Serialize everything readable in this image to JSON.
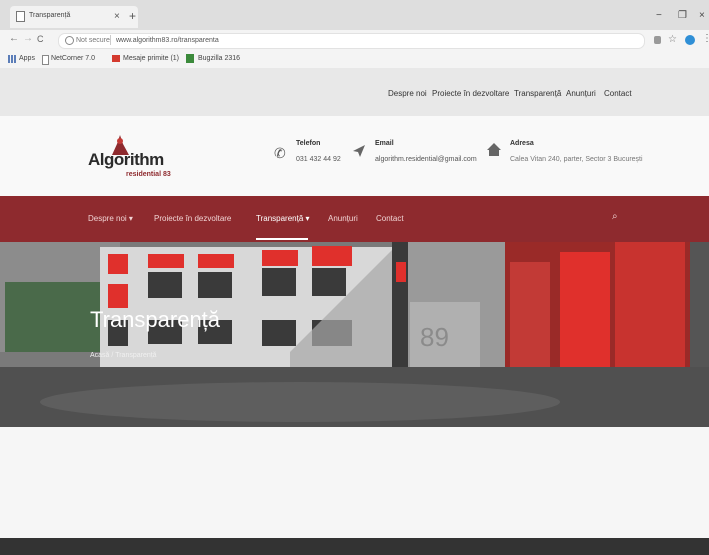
{
  "browser": {
    "tab_title": "Transparență",
    "close_glyph": "×",
    "new_tab_glyph": "+",
    "window_controls": [
      "−",
      "❐",
      "×"
    ],
    "back_glyph": "←",
    "forward_glyph": "→",
    "reload_glyph": "C",
    "not_secure": "Not secure",
    "url": "www.algorithm83.ro/transparenta",
    "bookmarks": [
      "Apps",
      "NetCorner 7.0",
      "Mesaje primite (1)",
      "Bugzilla 2316"
    ]
  },
  "site": {
    "topnav": [
      "Despre noi",
      "Proiecte în dezvoltare",
      "Transparență",
      "Anunțuri",
      "Contact"
    ],
    "logo": {
      "name": "Algorithm",
      "sub": "residential 83"
    },
    "contact": {
      "phone_label": "Telefon",
      "phone": "031 432 44 92",
      "email_label": "Email",
      "email": "algorithm.residential@gmail.com",
      "address_label": "Adresa",
      "address": "Calea Vitan 240, parter, Sector 3 București"
    },
    "mainnav": [
      "Despre noi",
      "Proiecte în dezvoltare",
      "Transparență",
      "Anunțuri",
      "Contact"
    ],
    "mainnav_caret": "▾",
    "search_glyph": "⌕",
    "hero": {
      "title": "Transparență",
      "breadcrumb_home": "Acasă",
      "breadcrumb_sep": "/",
      "breadcrumb_current": "Transparență",
      "building_number": "89"
    }
  },
  "colors": {
    "accent": "#8e2a2e",
    "hero_red": "#e0302c"
  }
}
